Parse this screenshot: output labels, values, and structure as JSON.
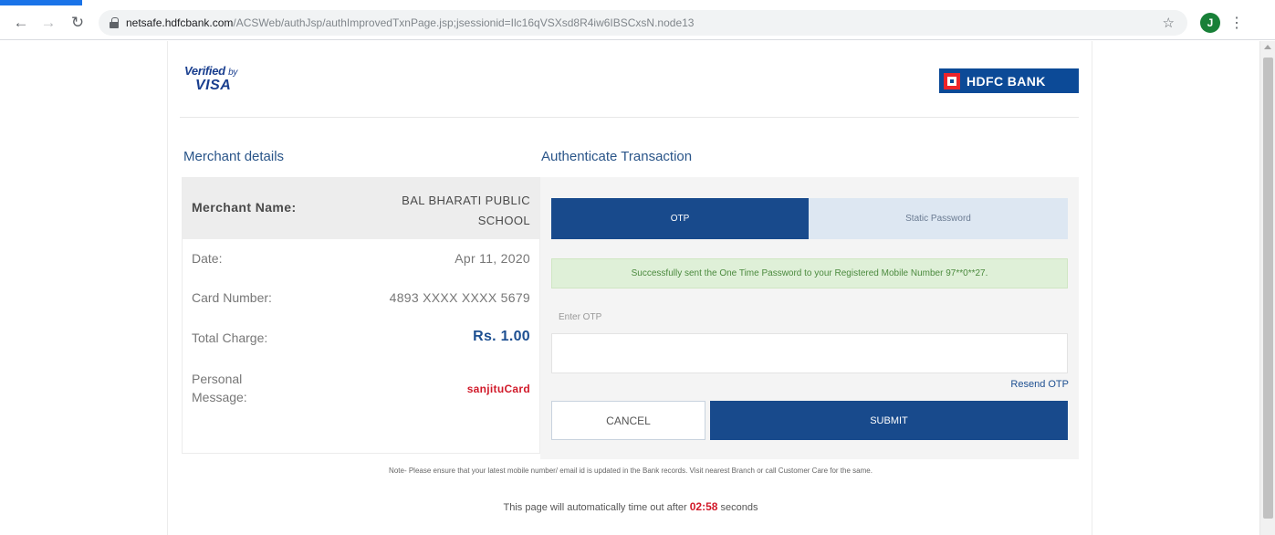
{
  "browser": {
    "url_host": "netsafe.hdfcbank.com",
    "url_path": "/ACSWeb/authJsp/authImprovedTxnPage.jsp;jsessionid=Ilc16qVSXsd8R4iw6IBSCxsN.node13",
    "avatar_letter": "J",
    "icons": {
      "back": "back-arrow-icon",
      "forward": "forward-arrow-icon",
      "reload": "reload-icon",
      "lock": "lock-icon",
      "star": "star-icon",
      "menu": "kebab-menu-icon"
    }
  },
  "header": {
    "visa_verified": "Verified",
    "visa_by": "by",
    "visa_name": "VISA",
    "bank_name": "HDFC BANK"
  },
  "merchant": {
    "section_title": "Merchant details",
    "name_label": "Merchant Name:",
    "name_value": "BAL BHARATI PUBLIC SCHOOL",
    "date_label": "Date:",
    "date_value": "Apr 11, 2020",
    "card_label": "Card Number:",
    "card_value": "4893 XXXX XXXX 5679",
    "total_label": "Total Charge:",
    "total_value": "Rs. 1.00",
    "message_label": "Personal Message:",
    "message_value": "sanjituCard"
  },
  "auth": {
    "section_title": "Authenticate Transaction",
    "tabs": [
      {
        "label": "OTP",
        "active": true
      },
      {
        "label": "Static Password",
        "active": false
      }
    ],
    "success_message": "Successfully sent the One Time Password to your Registered Mobile Number 97**0**27.",
    "otp_label": "Enter OTP",
    "otp_value": "",
    "resend_label": "Resend OTP",
    "cancel_label": "CANCEL",
    "submit_label": "SUBMIT"
  },
  "footer": {
    "note": "Note- Please ensure that your latest mobile number/ email id is updated in the Bank records. Visit nearest Branch or call Customer Care for the same.",
    "timeout_prefix": "This page will automatically time out after",
    "timeout_value": "02:58",
    "timeout_suffix": "seconds"
  },
  "colors": {
    "brand_blue": "#184a8c",
    "hdfc_red": "#ed232a",
    "success_bg": "#dff0d8",
    "alert_red": "#d11a2a"
  }
}
